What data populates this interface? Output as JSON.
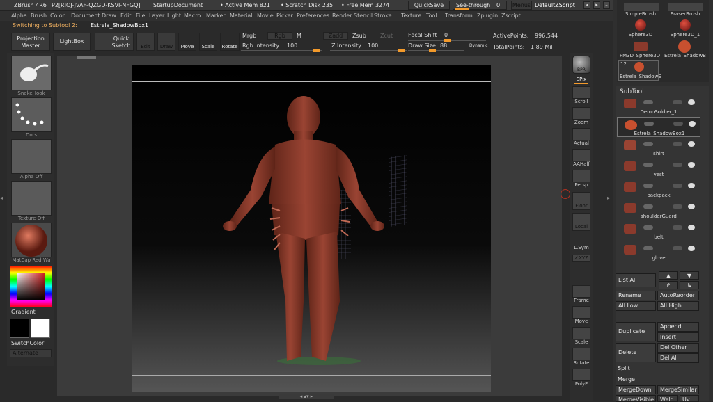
{
  "title": {
    "app": "ZBrush 4R6",
    "code": "P2[RIOJ-JVAF-QZGD-KSVI-NFGQ]",
    "doc": "StartupDocument",
    "active_mem": "• Active Mem 821",
    "scratch": "• Scratch Disk 235",
    "free_mem": "• Free Mem 3274",
    "quicksave": "QuickSave",
    "seethrough": "See-through",
    "seethrough_val": "0",
    "menus": "Menus",
    "script": "DefaultZScript"
  },
  "menu": [
    "Alpha",
    "Brush",
    "Color",
    "Document",
    "Draw",
    "Edit",
    "File",
    "Layer",
    "Light",
    "Macro",
    "Marker",
    "Material",
    "Movie",
    "Picker",
    "Preferences",
    "Render",
    "Stencil",
    "Stroke",
    "Texture",
    "Tool",
    "Transform",
    "Zplugin",
    "Zscript"
  ],
  "subtool_switch": {
    "label": "Switching to Subtool 2:",
    "name": "Estrela_ShadowBox1"
  },
  "toolbar": {
    "projection_master": "Projection Master",
    "lightbox": "LightBox",
    "quick_sketch": "Quick Sketch",
    "edit": "Edit",
    "draw": "Draw",
    "move": "Move",
    "scale": "Scale",
    "rotate": "Rotate",
    "mrgb": "Mrgb",
    "rgb": "Rgb",
    "m": "M",
    "zadd": "Zadd",
    "zsub": "Zsub",
    "zcut": "Zcut",
    "rgb_intensity_label": "Rgb Intensity",
    "rgb_intensity": "100",
    "z_intensity_label": "Z Intensity",
    "z_intensity": "100",
    "focal_shift_label": "Focal Shift",
    "focal_shift": "0",
    "draw_size_label": "Draw Size",
    "draw_size": "88",
    "dynamic": "Dynamic",
    "active_points_label": "ActivePoints:",
    "active_points": "996,544",
    "total_points_label": "TotalPoints:",
    "total_points": "1.89 Mil"
  },
  "left": {
    "brush": "SnakeHook",
    "stroke": "Dots",
    "alpha": "Alpha Off",
    "texture": "Texture Off",
    "material": "MatCap Red Wa",
    "gradient": "Gradient",
    "switch_color": "SwitchColor",
    "alternate": "Alternate"
  },
  "right": {
    "bpr": "BPR",
    "spix": "SPix",
    "scroll": "Scroll",
    "zoom": "Zoom",
    "actual": "Actual",
    "aahalf": "AAHalf",
    "persp": "Persp",
    "floor": "Floor",
    "local": "Local",
    "lsym": "L.Sym",
    "xyz": "∠XYZ",
    "frame": "Frame",
    "move": "Move",
    "scale": "Scale",
    "rotate": "Rotate",
    "polyf": "PolyF"
  },
  "tools": [
    {
      "name": "SimpleBrush"
    },
    {
      "name": "EraserBrush"
    },
    {
      "name": "Sphere3D"
    },
    {
      "name": "Sphere3D_1"
    },
    {
      "name": "PM3D_Sphere3D"
    },
    {
      "name": "Estrela_ShadowB"
    },
    {
      "name": "Estrela_ShadowE",
      "count": "12"
    }
  ],
  "subtool": {
    "title": "SubTool",
    "items": [
      "DemoSoldier_1",
      "Estrela_ShadowBox1",
      "shirt",
      "vest",
      "backpack",
      "shoulderGuard",
      "belt",
      "glove"
    ],
    "list_all": "List All",
    "rename": "Rename",
    "autoreorder": "AutoReorder",
    "all_low": "All Low",
    "all_high": "All High",
    "duplicate": "Duplicate",
    "append": "Append",
    "insert": "Insert",
    "delete": "Delete",
    "del_other": "Del Other",
    "del_all": "Del All",
    "split": "Split",
    "merge": "Merge",
    "merge_down": "MergeDown",
    "merge_similar": "MergeSimilar",
    "merge_visible": "MergeVisible",
    "weld": "Weld",
    "uv": "Uv"
  },
  "colors": {
    "accent": "#f39a2b",
    "model": "#8b3a2c",
    "bg": "#2a2a2a"
  }
}
